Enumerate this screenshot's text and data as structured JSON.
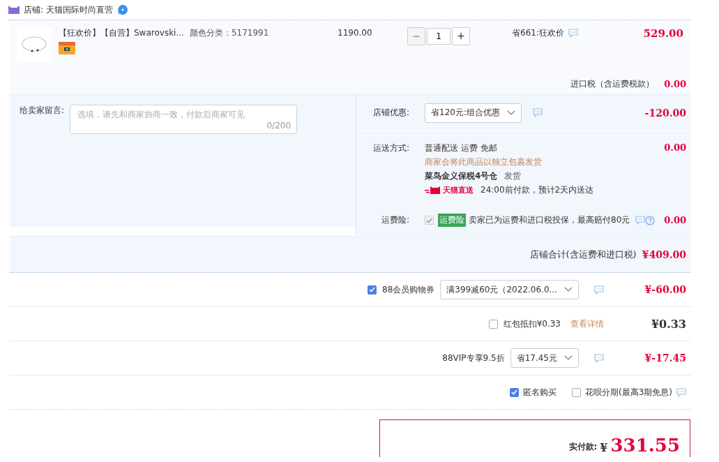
{
  "shop": {
    "label": "店铺: 天猫国际时尚直营"
  },
  "item": {
    "title": "【狂欢价】【自营】Swarovski...",
    "sku": "颜色分类：5171991",
    "unit_price": "1190.00",
    "decrease": "−",
    "quantity": "1",
    "increase": "+",
    "promo": "省661:狂欢价",
    "subtotal": "529.00"
  },
  "import_tax": {
    "label": "进口税（含运费税款）",
    "value": "0.00"
  },
  "message": {
    "label": "给卖家留言:",
    "placeholder": "选填，请先和商家协商一致，付款后商家可见",
    "counter": "0/200"
  },
  "store_discount": {
    "label": "店铺优惠:",
    "selection": "省120元:组合优惠",
    "value": "-120.00"
  },
  "shipping": {
    "label": "运送方式:",
    "method": "普通配送 运费 免邮",
    "note": "商家会将此商品以独立包裹发货",
    "warehouse": "菜鸟金义保税4号仓",
    "dispatch": "发货",
    "badge": "天猫直送",
    "eta": "24:00前付款，预计2天内送达",
    "value": "0.00"
  },
  "insurance": {
    "label": "运费险:",
    "checked": true,
    "disabled": true,
    "tag": "运费险",
    "text": "卖家已为运费和进口税投保，最高赔付80元",
    "value": "0.00"
  },
  "shop_total": {
    "label": "店铺合计(含运费和进口税)",
    "value": "¥409.00"
  },
  "coupon": {
    "checked": true,
    "label": "88会员购物券",
    "selection": "满399减60元（2022.06.0...",
    "value": "¥-60.00"
  },
  "red_packet": {
    "checked": false,
    "label": "红包抵扣¥0.33",
    "link": "查看详情",
    "value": "¥0.33"
  },
  "vip": {
    "label": "88VIP专享9.5折",
    "selection": "省17.45元",
    "value": "¥-17.45"
  },
  "options": [
    {
      "label": "匿名购买",
      "checked": true
    },
    {
      "label": "花呗分期(最高3期免息)",
      "checked": false
    }
  ],
  "payment": {
    "label": "实付款:",
    "currency": "¥",
    "amount": "331.55"
  }
}
